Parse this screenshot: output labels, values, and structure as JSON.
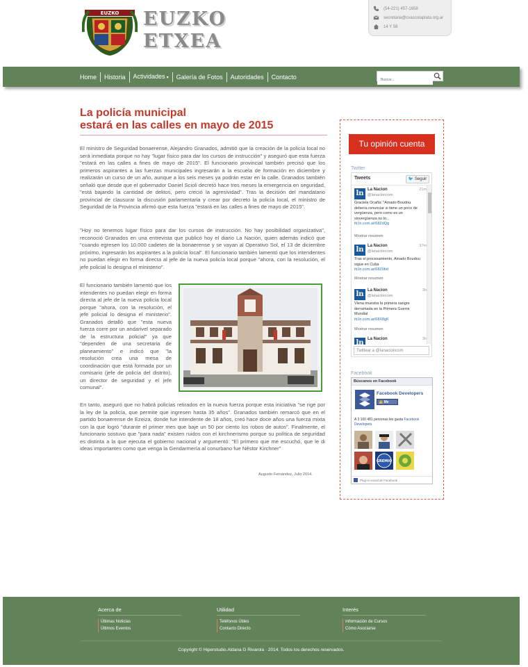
{
  "header": {
    "logo_line1": "EUZKO",
    "logo_line2": "ETXEA",
    "crest_text": "EUZKO",
    "contact": {
      "phone": "(54-221) 457-1658",
      "email": "secretaria@cvascolaplata.org.ar",
      "address": "14 Y 58"
    }
  },
  "nav": {
    "items": [
      "Home",
      "Historia",
      "Actividades",
      "Galería de Fotos",
      "Autoridades",
      "Contacto"
    ],
    "dropdown_caret": "▾",
    "search_placeholder": "Buscar..."
  },
  "article": {
    "title_line1": "La policía municipal",
    "title_line2": "estará en las calles en mayo de 2015",
    "p1": "El ministro de Seguridad bonaerense, Alejandro Granados, admitió que la creación de la policía local no será inmediata porque no hay \"lugar físico para dar los cursos de instrucción\" y aseguró que esta fuerza \"estará en las calles a fines de mayo de 2015\". El funcionario provincial también precisó que los primeros aspirantes a las fuerzas municipales ingresarán a la escuela de formación en diciembre y realizarán un curso de un año, aunque a los seis meses ya podrán estar en la calle. Granados también señaló que desde que el gobernador Daniel Scioli decretó hace tres meses la emergencia en seguridad, \"está bajando la cantidad de delitos, pero creció la agresividad\". Tras la decisión del mandatario provincial de clausurar la discusión parlamentaria y crear por decreto la policía local, el ministro de Seguridad de la Provincia afirmó que esta fuerza \"estará en las calles a fines de mayo de 2015\".",
    "p2": "\"Hoy no tenemos lugar físico para dar los cursos de instrucción. No hay posibilidad organizativa\", reconoció Granados en una entrevista que publicó hoy el diario La Nación, quien además indicó que \"cuando egresen los 10.000 cadetes de la bonaerense y se vayan al Operativo Sol, el 13 de diciembre próximo, ingresarán los aspirantes a la policía local\". El funcionario también lamentó que los intendentes no puedan elegir en forma directa al jefe de la nueva policía local porque \"ahora, con la resolución, el jefe policial lo designa el ministerio\".",
    "p3": "El funcionario también lamentó que los intendentes no puedan elegir en forma directa al jefe de la nueva policía local porque \"ahora, con la resolución, el jefe policial lo designa el ministerio\". Granados detalló que \"esta nueva fuerza corre por un andarivel separado de la estructura policial\" ya que \"dependen de una secretaria de planeamiento\" e indicó que \"la resolución crea una mesa de coordinación que está formada por un comisario (jefe de policía del distrito), un director de seguridad y el jefe comunal\".",
    "p4": "En tanto, aseguró que no habrá policías retirados en la nueva fuerza porque esta iniciativa \"se rige por la ley de la policía, que permite que ingresen hasta 35 años\". Granados también remarcó que en el partido bonaerense de Ezeiza, donde fue intendente de 18 años, creó hace doce años una fuerza mixta con la que logró \"durante el primer mes que baje un 50 por ciento los robos de autos\". Finalmente, el funcionario sostuvo que \"para nada\" existen ruidos con el kirchnerismo porque su política de seguridad es distinta a la que ejecuta el gobierno nacional y argumentó: \"El primero que me escuchó, que le di ideas importantes como que venga la Gendarmería al conurbano fue Néstor Kirchner\"",
    "author": "Augusto Fernández, Julio 2014."
  },
  "sidebar": {
    "opinion_label": "Tu opinión cuenta",
    "twitter": {
      "section_label": "Twitter",
      "header": "Tweets",
      "follow_label": "Seguir",
      "reply_placeholder": "Twittear a @lanacioncom",
      "tweets": [
        {
          "avatar": "ln",
          "name": "La Nacion",
          "handle": "@lanacioncom",
          "time": "21m",
          "text": "Graciela Ocaña: \"Amado Boudou debería renunciar si tiene un poco de vergüenza, pero como es un sinvergüenza no lo...",
          "link": "fd.ln.com.ar/68ZdQg",
          "show": "Mostrar resumen"
        },
        {
          "avatar": "ln",
          "name": "La Nacion",
          "handle": "@lanacioncom",
          "time": "37m",
          "text": "Tras el procesamiento, Amado Boudou sigue en Cuba",
          "link": "fd.ln.com.ar/68Z0bd",
          "show": "Mostrar resumen"
        },
        {
          "avatar": "ln",
          "name": "La Nacion",
          "handle": "@lanacioncom",
          "time": "3h",
          "text": "Viena muestra la primera sangre derramada en la Primera Guerra Mundial",
          "link": "fd.ln.com.ar/68X8gK",
          "show": "Mostrar resumen"
        },
        {
          "avatar": "ln",
          "name": "La Nacion",
          "handle": "@lanacioncom",
          "time": "3h",
          "text": "",
          "link": "",
          "show": ""
        }
      ]
    },
    "facebook": {
      "section_label": "Facebook",
      "header": "Búscanos en Facebook",
      "page_name": "Facebook Developers",
      "like_label": "Me gusta",
      "count_text": "A 3 100 481 personas les gusta",
      "count_link": "Facebook Developers.",
      "face_badge": "GREMIO",
      "plugin_label": "Plug-in social de Facebook"
    }
  },
  "footer": {
    "columns": [
      {
        "heading": "Acerca de",
        "links": [
          "Últimas Noticias",
          "Últimos Eventos"
        ]
      },
      {
        "heading": "Utilidad",
        "links": [
          "Teléfonos Útiles",
          "Contacto Directo"
        ]
      },
      {
        "heading": "Interés",
        "links": [
          "Información de Cursos",
          "Cómo Asociarse"
        ]
      }
    ],
    "copyright": "Copyright © Hiperstudio.Aldana G Rivarola · 2014. Todos los derechos reservados."
  },
  "colors": {
    "nav_green": "#628259",
    "title_red": "#c0392b",
    "opinion_red": "#d8301f",
    "facebook_blue": "#3b5998"
  }
}
